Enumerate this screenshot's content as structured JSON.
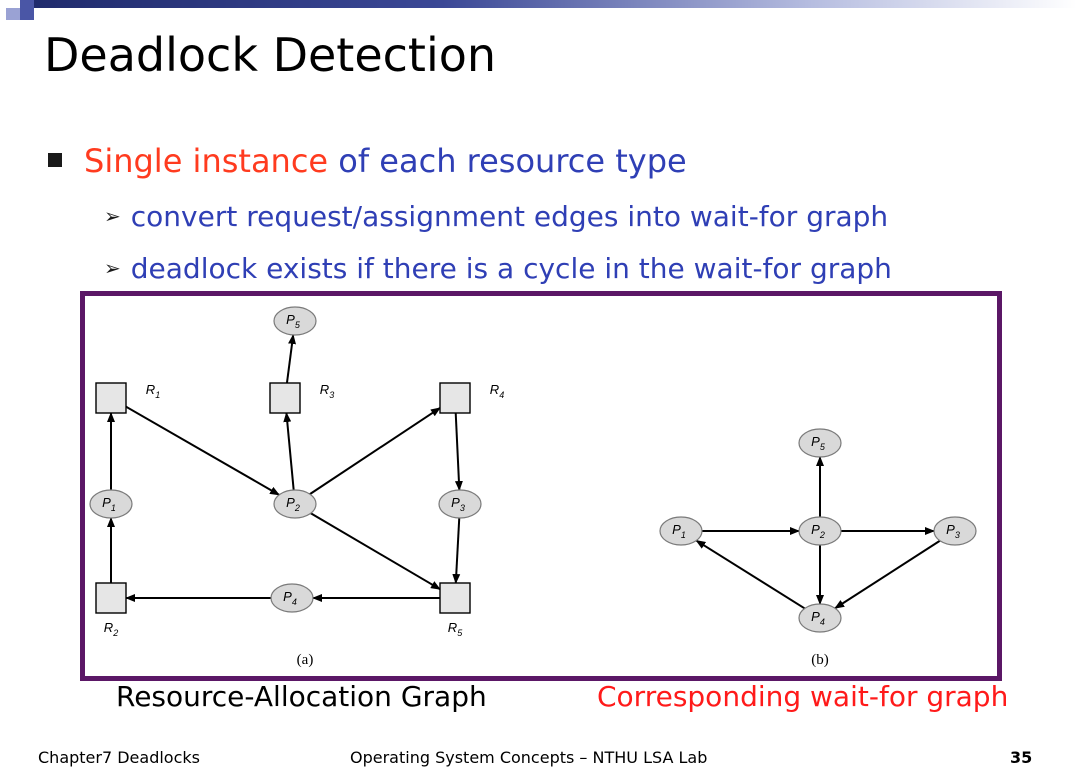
{
  "slide": {
    "title": "Deadlock Detection",
    "bullet": {
      "highlight": "Single instance",
      "rest": " of each resource type"
    },
    "subbullets": [
      "convert request/assignment edges into wait-for graph",
      "deadlock exists if there is a cycle in the wait-for graph"
    ],
    "captions": {
      "left": "Resource-Allocation Graph",
      "right": "Corresponding wait-for graph"
    },
    "footer": {
      "chapter": "Chapter7 Deadlocks",
      "course": "Operating System Concepts – NTHU LSA Lab",
      "page": "35"
    }
  },
  "figure": {
    "a": {
      "caption": "(a)",
      "resources": [
        "R1",
        "R2",
        "R3",
        "R4",
        "R5"
      ],
      "processes": [
        "P1",
        "P2",
        "P3",
        "P4",
        "P5"
      ],
      "edges": [
        [
          "P1",
          "R1"
        ],
        [
          "R2",
          "P1"
        ],
        [
          "R1",
          "P2"
        ],
        [
          "P2",
          "R3"
        ],
        [
          "R3",
          "P5"
        ],
        [
          "P2",
          "R4"
        ],
        [
          "R4",
          "P3"
        ],
        [
          "P2",
          "R5"
        ],
        [
          "P3",
          "R5"
        ],
        [
          "R5",
          "P4"
        ],
        [
          "P4",
          "R2"
        ]
      ]
    },
    "b": {
      "caption": "(b)",
      "processes": [
        "P1",
        "P2",
        "P3",
        "P4",
        "P5"
      ],
      "edges": [
        [
          "P1",
          "P2"
        ],
        [
          "P2",
          "P3"
        ],
        [
          "P2",
          "P5"
        ],
        [
          "P2",
          "P4"
        ],
        [
          "P3",
          "P4"
        ],
        [
          "P4",
          "P1"
        ]
      ]
    },
    "colors": {
      "frame": "#5b1766",
      "node_fill": "#d9d9d9",
      "box_fill": "#e6e6e6"
    }
  }
}
